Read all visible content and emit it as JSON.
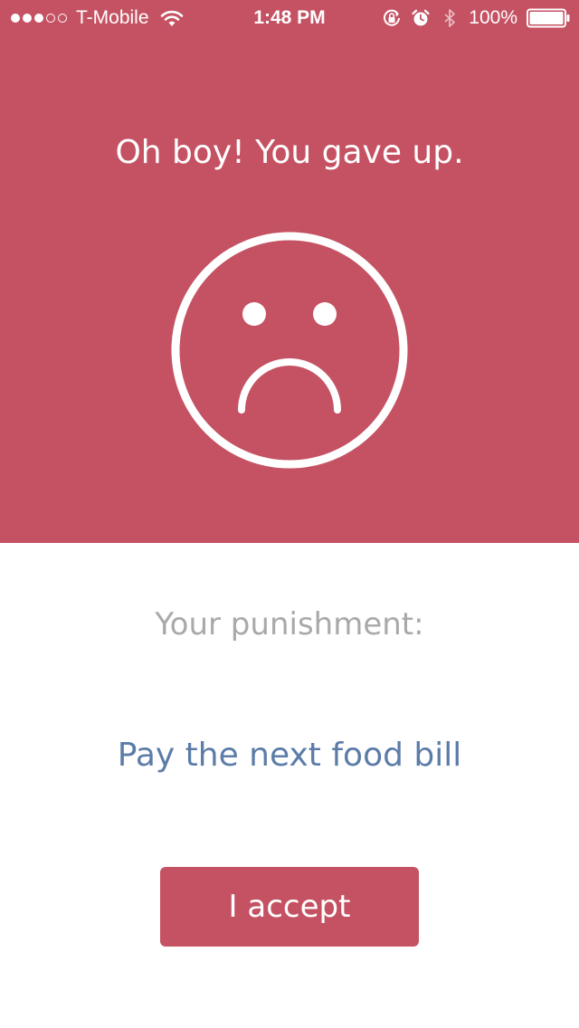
{
  "status_bar": {
    "carrier": "T-Mobile",
    "signal_filled": 3,
    "signal_total": 5,
    "time": "1:48 PM",
    "battery_percent_label": "100%",
    "battery_level": 1.0,
    "icons": [
      "wifi-icon",
      "orientation-lock-icon",
      "alarm-icon",
      "bluetooth-icon",
      "battery-icon"
    ]
  },
  "header": {
    "title": "Oh boy! You gave up."
  },
  "face": {
    "icon": "sad-face-icon"
  },
  "punishment": {
    "label": "Your punishment:",
    "text": "Pay the next food bill"
  },
  "actions": {
    "accept_label": "I accept"
  },
  "colors": {
    "accent": "#c55263",
    "label_gray": "#a9a9a9",
    "punishment_blue": "#5c7ca8",
    "background": "#ffffff"
  }
}
